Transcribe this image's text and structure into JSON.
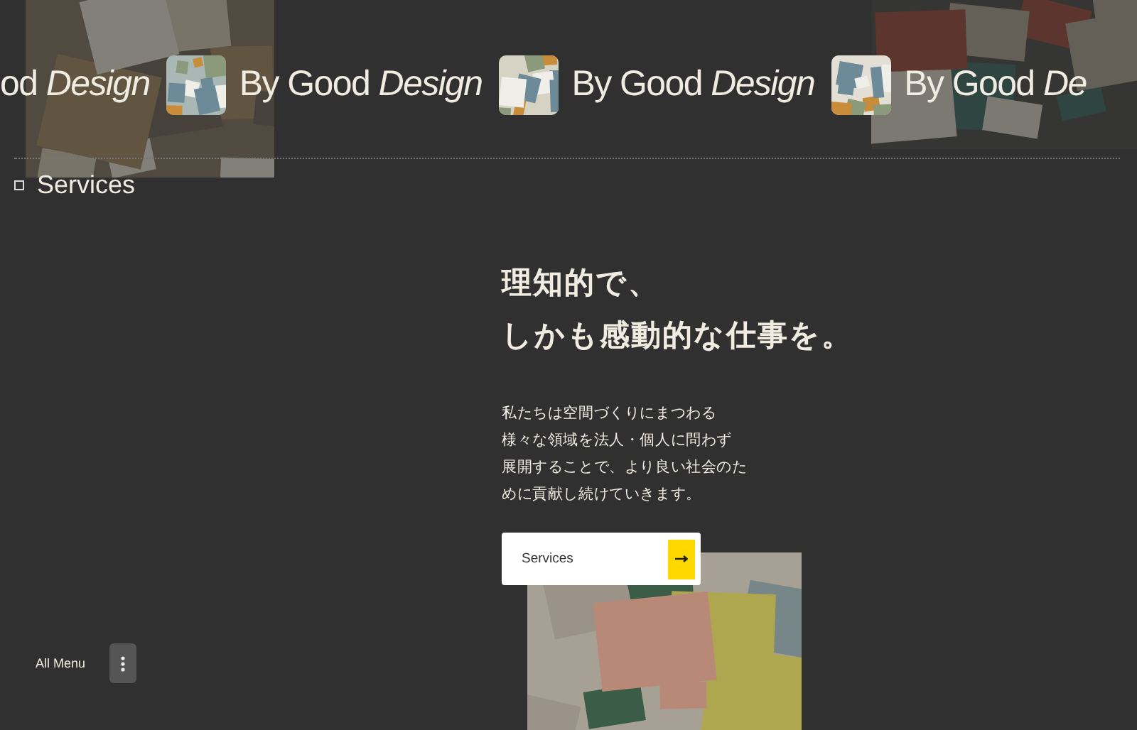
{
  "marquee": [
    {
      "kind": "text",
      "text": "od *Design*"
    },
    {
      "kind": "picture"
    },
    {
      "kind": "text",
      "text": "By Good *Design*"
    },
    {
      "kind": "picture"
    },
    {
      "kind": "text",
      "text": "By Good *Design*"
    },
    {
      "kind": "picture"
    },
    {
      "kind": "text",
      "text": "By Good *De*"
    }
  ],
  "nav": {
    "label": "Services"
  },
  "hero": {
    "heading_lines": [
      "理知的で、",
      "しかも感動的な仕事を。"
    ],
    "body_lines": [
      "私たちは空間づくりにまつわる",
      "様々な領域を法人・個人に問わず",
      "展開することで、より良い社会のた",
      "めに貢献し続けていきます。"
    ],
    "button": {
      "label": "Services"
    }
  },
  "footer": {
    "menu_label": "All Menu"
  }
}
